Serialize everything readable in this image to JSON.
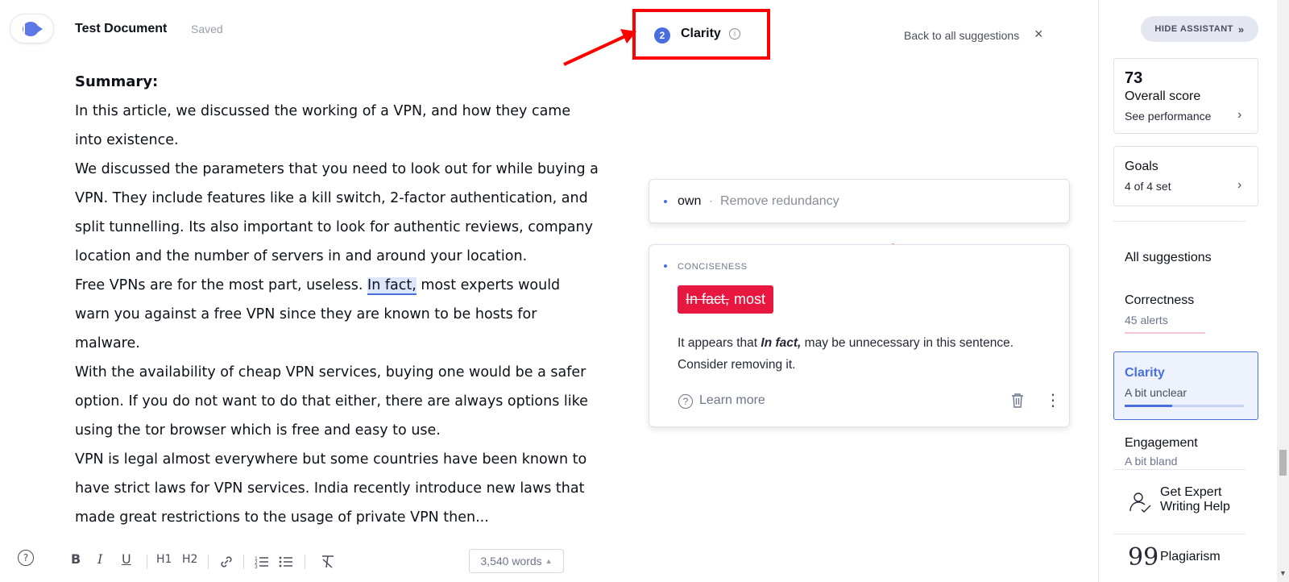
{
  "header": {
    "doc_title": "Test Document",
    "doc_status": "Saved"
  },
  "assistant": {
    "category_count": "2",
    "category_title": "Clarity",
    "back_label": "Back to all suggestions",
    "close_glyph": "×"
  },
  "editor": {
    "heading": "Summary:",
    "paragraphs": [
      "In this article, we discussed the working of a VPN, and how they came into existence.",
      "We discussed the parameters that you need to look out for while buying a VPN. They include features like a kill switch, 2-factor authentication, and split tunnelling. Its also important to look for authentic reviews, company location and the number of servers in and around your location."
    ],
    "para3_before": "Free VPNs are for the most part, useless. ",
    "para3_highlight": "In fact,",
    "para3_after": " most experts would warn you against a free VPN since they are known to be hosts for malware.",
    "paragraphs_after": [
      "With the availability of cheap VPN services, buying one would be a safer option. If you do not want to do that either, there are always options like using the tor browser which is free and easy to use.",
      "VPN is legal almost everywhere but some countries have been known to have strict laws for VPN services. India recently introduce new laws that made great restrictions to the usage of private VPN then..."
    ]
  },
  "toolbar": {
    "help": "?",
    "bold": "B",
    "italic": "I",
    "underline": "U",
    "h1": "H1",
    "h2": "H2",
    "word_count": "3,540 words"
  },
  "cards": {
    "redundancy": {
      "word": "own",
      "separator": "·",
      "description": "Remove redundancy"
    },
    "conciseness": {
      "category": "CONCISENESS",
      "remove_text": "In fact,",
      "keep_text": "most",
      "msg_before": "It appears that ",
      "msg_bold": "In fact,",
      "msg_after": " may be unnecessary in this sentence. Consider removing it.",
      "learn_more": "Learn more"
    }
  },
  "sidebar": {
    "hide_label": "HIDE ASSISTANT",
    "score_value": "73",
    "score_label": "Overall score",
    "score_link": "See performance",
    "goals_title": "Goals",
    "goals_sub": "4 of 4 set",
    "all_suggestions": "All suggestions",
    "correctness_title": "Correctness",
    "correctness_sub": "45 alerts",
    "clarity_title": "Clarity",
    "clarity_sub": "A bit unclear",
    "clarity_level": 0.4,
    "engagement_title": "Engagement",
    "engagement_sub": "A bit bland",
    "expert_label_1": "Get Expert",
    "expert_label_2": "Writing Help",
    "plagiarism_label": "Plagiarism"
  },
  "colors": {
    "accent": "#4a6ee0",
    "error_red": "#e8173f",
    "annotation_red": "#ff0000"
  }
}
